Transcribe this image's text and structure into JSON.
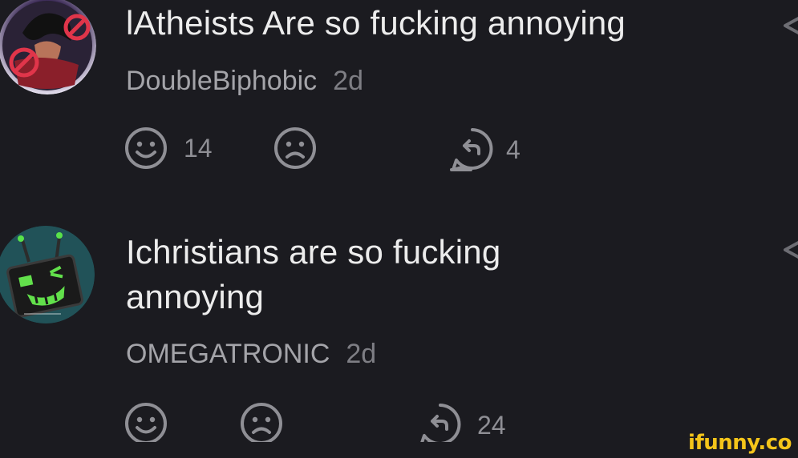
{
  "comments": [
    {
      "text": "lAtheists Are so fucking annoying",
      "user": "DoubleBiphobic",
      "time": "2d",
      "smile_count": "14",
      "frown_count": "",
      "reply_count": "4"
    },
    {
      "text": "Ichristians are so fucking annoying",
      "user": "OMEGATRONIC",
      "time": "2d",
      "smile_count": "",
      "frown_count": "",
      "reply_count": "24"
    }
  ],
  "icons": {
    "smile": "smile-icon",
    "frown": "frown-icon",
    "reply": "reply-icon",
    "share": "share-icon"
  },
  "colors": {
    "background": "#1b1b20",
    "text": "#ececec",
    "meta": "#8d8d93",
    "watermark": "#f4c51a"
  },
  "watermark": "ifunny.co"
}
